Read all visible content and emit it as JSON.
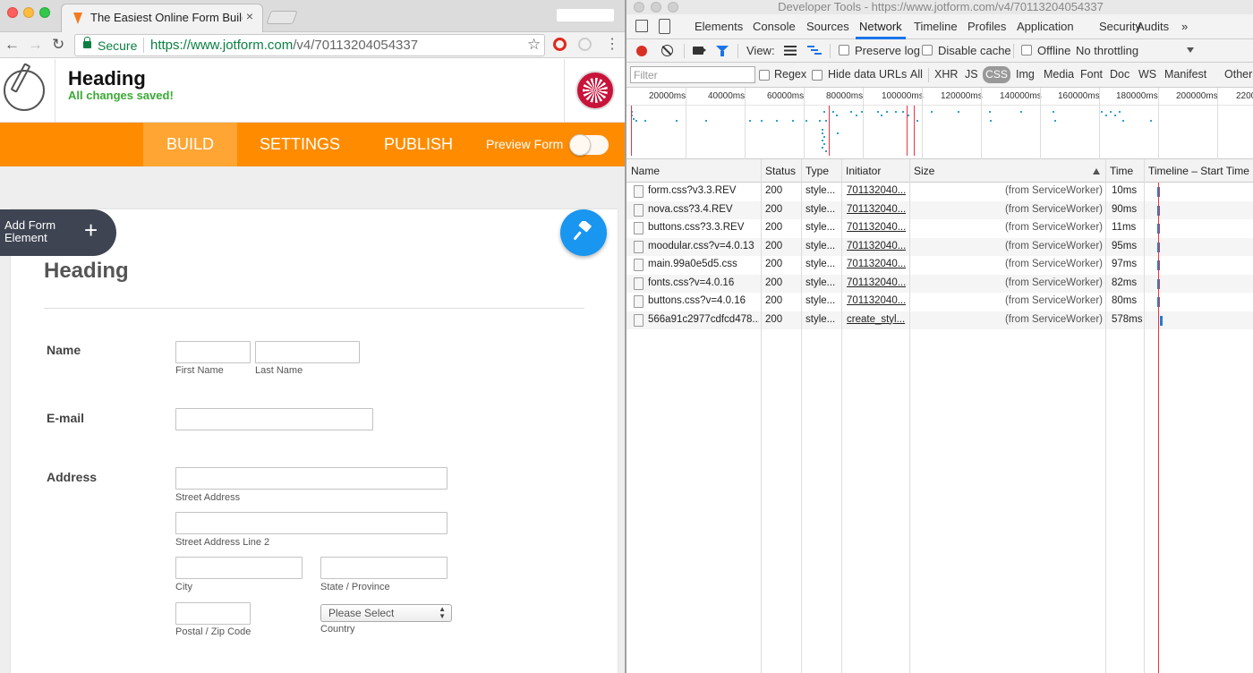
{
  "browser": {
    "tab_title": "The Easiest Online Form Builder",
    "tab_close": "×",
    "secure_label": "Secure",
    "url_host": "https://www.jotform.com",
    "url_path": "/v4/70113204054337",
    "icons": {
      "back": "arrow-left-icon",
      "forward": "arrow-right-icon",
      "reload": "reload-icon",
      "lock": "lock-icon",
      "star": "star-icon",
      "menu": "more-vert-icon"
    }
  },
  "jotform": {
    "form_title": "Heading",
    "save_status": "All changes saved!",
    "nav": {
      "build": "BUILD",
      "settings": "SETTINGS",
      "publish": "PUBLISH",
      "preview": "Preview Form"
    },
    "add_form_element": "Add Form Element",
    "add_icon": "+",
    "colors": {
      "nav_bg": "#ff8c00",
      "nav_active": "#ffa533",
      "saved_green": "#3aaa35",
      "paint_button": "#1896f0",
      "add_button": "#3e4452"
    },
    "form": {
      "heading": "Heading",
      "name_label": "Name",
      "first_name": "First Name",
      "last_name": "Last Name",
      "email_label": "E-mail",
      "address_label": "Address",
      "street_address": "Street Address",
      "street_address_2": "Street Address Line 2",
      "city": "City",
      "state": "State / Province",
      "postal": "Postal / Zip Code",
      "country": "Country",
      "country_select": "Please Select"
    }
  },
  "devtools": {
    "window_title": "Developer Tools - https://www.jotform.com/v4/70113204054337",
    "tabs": [
      "Elements",
      "Console",
      "Sources",
      "Network",
      "Timeline",
      "Profiles",
      "Application",
      "Security",
      "Audits",
      "»"
    ],
    "active_tab": "Network",
    "toolbar": {
      "view_label": "View:",
      "preserve_log": "Preserve log",
      "disable_cache": "Disable cache",
      "offline": "Offline",
      "throttling": "No throttling"
    },
    "filter": {
      "placeholder": "Filter",
      "regex": "Regex",
      "hide_data_urls": "Hide data URLs",
      "types": [
        "All",
        "XHR",
        "JS",
        "CSS",
        "Img",
        "Media",
        "Font",
        "Doc",
        "WS",
        "Manifest",
        "Other"
      ],
      "active_type": "CSS"
    },
    "overview_ticks": [
      "20000ms",
      "40000ms",
      "60000ms",
      "80000ms",
      "100000ms",
      "120000ms",
      "140000ms",
      "160000ms",
      "180000ms",
      "200000ms",
      "2200"
    ],
    "columns": {
      "name": "Name",
      "status": "Status",
      "type": "Type",
      "initiator": "Initiator",
      "size": "Size",
      "time": "Time",
      "timeline": "Timeline – Start Time"
    },
    "rows": [
      {
        "name": "form.css?v3.3.REV",
        "status": "200",
        "type": "style...",
        "initiator": "701132040...",
        "size": "(from ServiceWorker)",
        "time": "10ms"
      },
      {
        "name": "nova.css?3.4.REV",
        "status": "200",
        "type": "style...",
        "initiator": "701132040...",
        "size": "(from ServiceWorker)",
        "time": "90ms"
      },
      {
        "name": "buttons.css?3.3.REV",
        "status": "200",
        "type": "style...",
        "initiator": "701132040...",
        "size": "(from ServiceWorker)",
        "time": "11ms"
      },
      {
        "name": "moodular.css?v=4.0.13",
        "status": "200",
        "type": "style...",
        "initiator": "701132040...",
        "size": "(from ServiceWorker)",
        "time": "95ms"
      },
      {
        "name": "main.99a0e5d5.css",
        "status": "200",
        "type": "style...",
        "initiator": "701132040...",
        "size": "(from ServiceWorker)",
        "time": "97ms"
      },
      {
        "name": "fonts.css?v=4.0.16",
        "status": "200",
        "type": "style...",
        "initiator": "701132040...",
        "size": "(from ServiceWorker)",
        "time": "82ms"
      },
      {
        "name": "buttons.css?v=4.0.16",
        "status": "200",
        "type": "style...",
        "initiator": "701132040...",
        "size": "(from ServiceWorker)",
        "time": "80ms"
      },
      {
        "name": "566a91c2977cdfcd478...",
        "status": "200",
        "type": "style...",
        "initiator": "create_styl...",
        "size": "(from ServiceWorker)",
        "time": "578ms"
      }
    ]
  }
}
